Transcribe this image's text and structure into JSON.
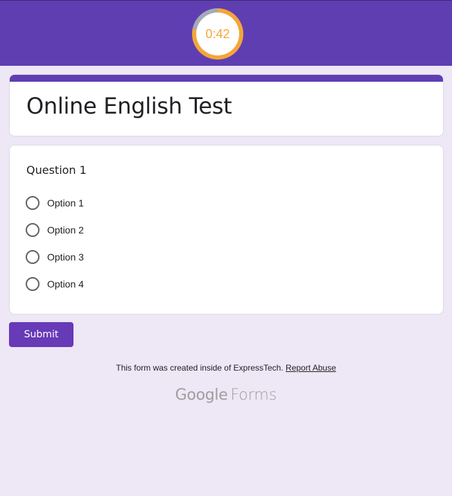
{
  "header": {
    "timer": {
      "label": "0:42",
      "elapsed_fraction": 0.22,
      "ring_color": "#f4a638",
      "track_color": "#a4aab8"
    },
    "background_color": "#5f3eb2"
  },
  "form": {
    "title": "Online English Test",
    "question": {
      "title": "Question 1",
      "options": [
        "Option 1",
        "Option 2",
        "Option 3",
        "Option 4"
      ]
    },
    "submit_label": "Submit"
  },
  "footer": {
    "note": "This form was created inside of ExpressTech.",
    "report_link": "Report Abuse",
    "brand_google": "Google",
    "brand_forms": "Forms"
  }
}
